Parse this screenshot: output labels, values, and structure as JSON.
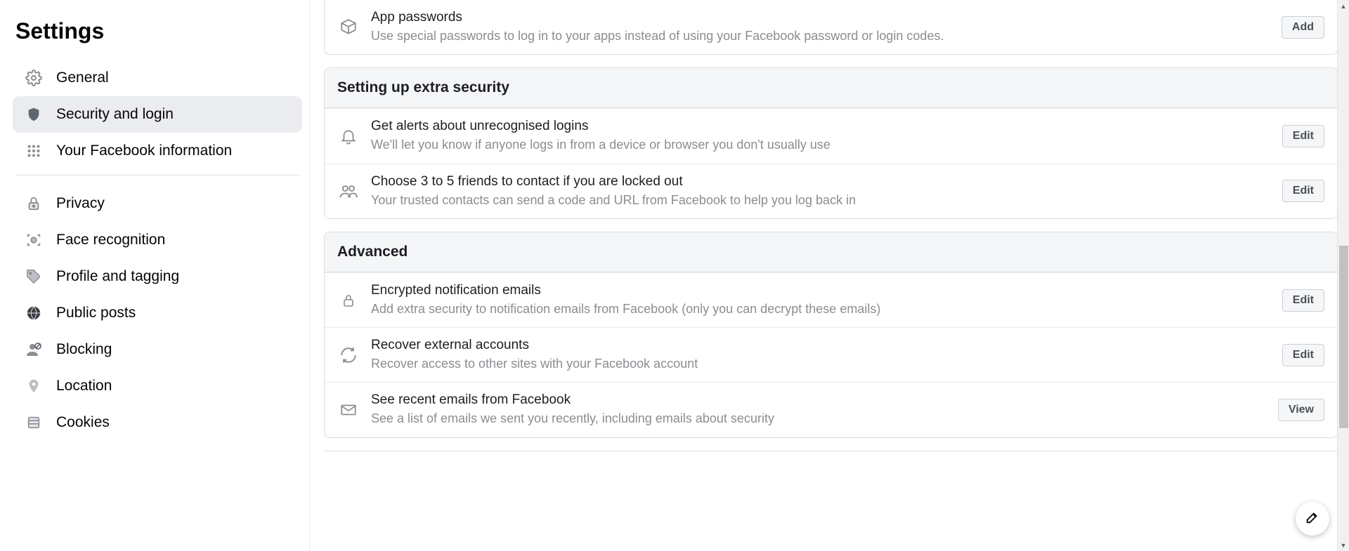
{
  "sidebar": {
    "title": "Settings",
    "items": [
      {
        "label": "General"
      },
      {
        "label": "Security and login"
      },
      {
        "label": "Your Facebook information"
      },
      {
        "label": "Privacy"
      },
      {
        "label": "Face recognition"
      },
      {
        "label": "Profile and tagging"
      },
      {
        "label": "Public posts"
      },
      {
        "label": "Blocking"
      },
      {
        "label": "Location"
      },
      {
        "label": "Cookies"
      }
    ]
  },
  "sections": {
    "app_passwords": {
      "title": "App passwords",
      "desc": "Use special passwords to log in to your apps instead of using your Facebook password or login codes.",
      "button": "Add"
    },
    "extra_security": {
      "header": "Setting up extra security",
      "rows": [
        {
          "title": "Get alerts about unrecognised logins",
          "desc": "We'll let you know if anyone logs in from a device or browser you don't usually use",
          "button": "Edit"
        },
        {
          "title": "Choose 3 to 5 friends to contact if you are locked out",
          "desc": "Your trusted contacts can send a code and URL from Facebook to help you log back in",
          "button": "Edit"
        }
      ]
    },
    "advanced": {
      "header": "Advanced",
      "rows": [
        {
          "title": "Encrypted notification emails",
          "desc": "Add extra security to notification emails from Facebook (only you can decrypt these emails)",
          "button": "Edit"
        },
        {
          "title": "Recover external accounts",
          "desc": "Recover access to other sites with your Facebook account",
          "button": "Edit"
        },
        {
          "title": "See recent emails from Facebook",
          "desc": "See a list of emails we sent you recently, including emails about security",
          "button": "View"
        }
      ]
    }
  }
}
